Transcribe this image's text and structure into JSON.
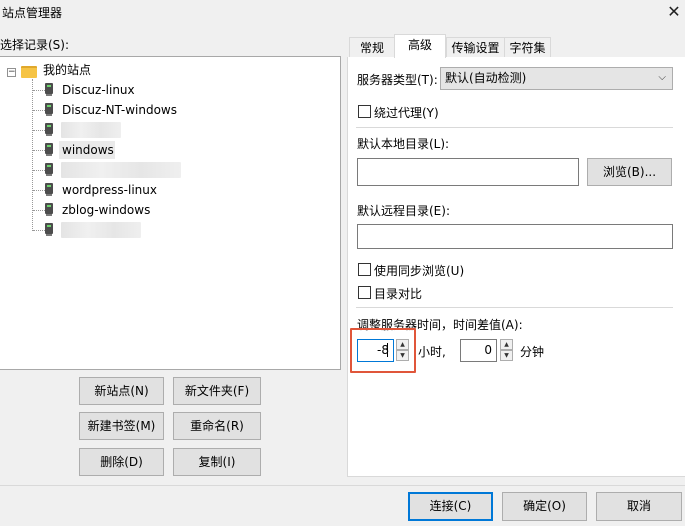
{
  "window": {
    "title": "站点管理器",
    "close_glyph": "✕"
  },
  "site_list": {
    "label": "选择记录(S):",
    "root": {
      "name": "我的站点",
      "expand_glyph": "−"
    },
    "sites": [
      {
        "name": "Discuz-linux"
      },
      {
        "name": "Discuz-NT-windows"
      },
      {
        "name": ""
      },
      {
        "name": "windows"
      },
      {
        "name": ""
      },
      {
        "name": "wordpress-linux"
      },
      {
        "name": "zblog-windows"
      },
      {
        "name": ""
      }
    ]
  },
  "left_buttons": {
    "new_site": "新站点(N)",
    "new_folder": "新文件夹(F)",
    "new_bookmark": "新建书签(M)",
    "rename": "重命名(R)",
    "delete": "删除(D)",
    "copy": "复制(I)"
  },
  "tabs": [
    {
      "label": "常规"
    },
    {
      "label": "高级",
      "active": true
    },
    {
      "label": "传输设置"
    },
    {
      "label": "字符集"
    }
  ],
  "advanced": {
    "server_type_label": "服务器类型(T):",
    "server_type_value": "默认(自动检测)",
    "bypass_proxy_label": "绕过代理(Y)",
    "bypass_proxy_checked": false,
    "local_dir_label": "默认本地目录(L):",
    "local_dir_value": "",
    "browse_label": "浏览(B)...",
    "remote_dir_label": "默认远程目录(E):",
    "remote_dir_value": "",
    "sync_browse_label": "使用同步浏览(U)",
    "sync_browse_checked": false,
    "dir_compare_label": "目录对比",
    "dir_compare_checked": false,
    "time_offset_label": "调整服务器时间，时间差值(A):",
    "hours_value": "-8",
    "hours_unit": "小时,",
    "minutes_value": "0",
    "minutes_unit": "分钟"
  },
  "dialog_buttons": {
    "connect": "连接(C)",
    "ok": "确定(O)",
    "cancel": "取消"
  },
  "colors": {
    "highlight_box": "#e0563a",
    "focus_border": "#0078d7",
    "folder": "#f6c445"
  }
}
